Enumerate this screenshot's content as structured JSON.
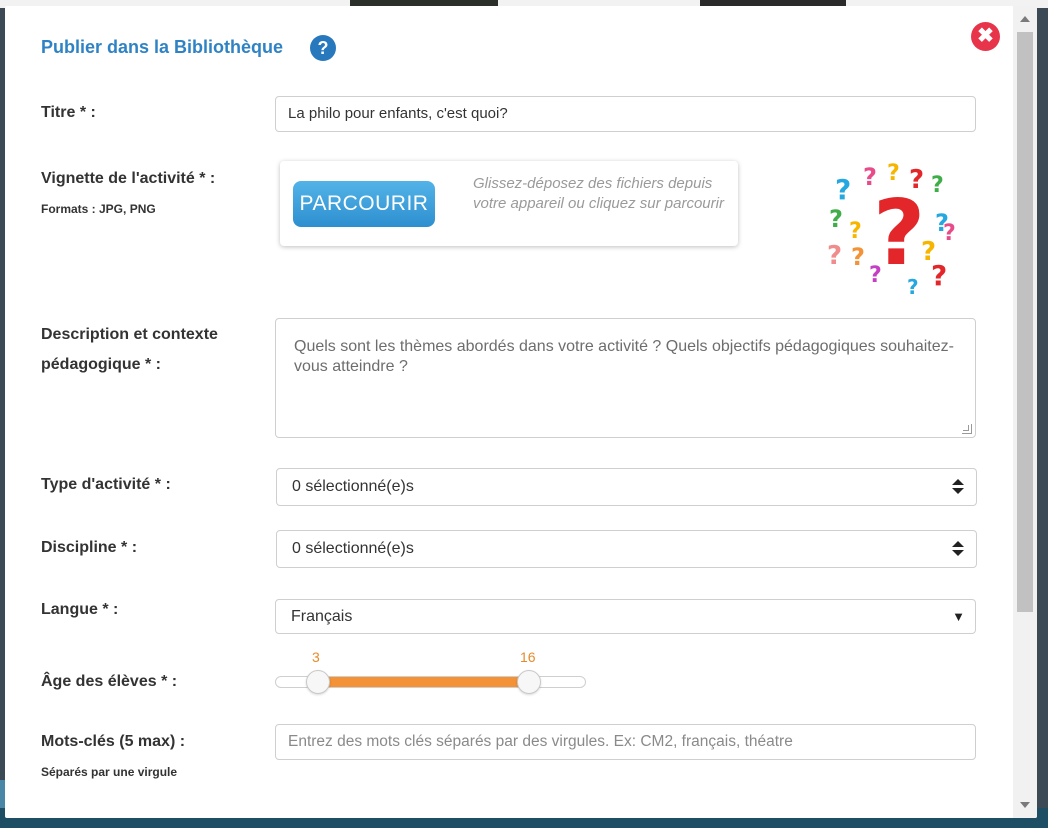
{
  "modal": {
    "title": "Publier dans la Bibliothèque",
    "help_icon": "?",
    "close_icon": "✖"
  },
  "fields": {
    "title": {
      "label": "Titre * :",
      "value": "La philo pour enfants, c'est quoi?"
    },
    "thumbnail": {
      "label": "Vignette de l'activité * :",
      "formats": "Formats : JPG, PNG",
      "browse_label": "PARCOURIR",
      "drop_text": "Glissez-déposez des fichiers depuis votre appareil ou cliquez sur parcourir",
      "image_icon": "question-marks-image"
    },
    "description": {
      "label_line1": "Description et contexte",
      "label_line2": "pédagogique * :",
      "placeholder": "Quels sont les thèmes abordés dans votre activité ? Quels objectifs pédagogiques souhaitez-vous atteindre ?"
    },
    "activity_type": {
      "label": "Type d'activité * :",
      "value": "0 sélectionné(e)s"
    },
    "discipline": {
      "label": "Discipline * :",
      "value": "0 sélectionné(e)s"
    },
    "language": {
      "label": "Langue * :",
      "value": "Français",
      "caret": "▼"
    },
    "age": {
      "label": "Âge des élèves * :",
      "min": "3",
      "max": "16",
      "accent": "#f39236"
    },
    "keywords": {
      "label": "Mots-clés (5 max) :",
      "hint": "Séparés par une virgule",
      "placeholder": "Entrez des mots clés séparés par des virgules. Ex: CM2, français, théatre"
    }
  },
  "colors": {
    "title": "#2f83c4",
    "close": "#e8344b",
    "browse": "#3ba0dc"
  }
}
